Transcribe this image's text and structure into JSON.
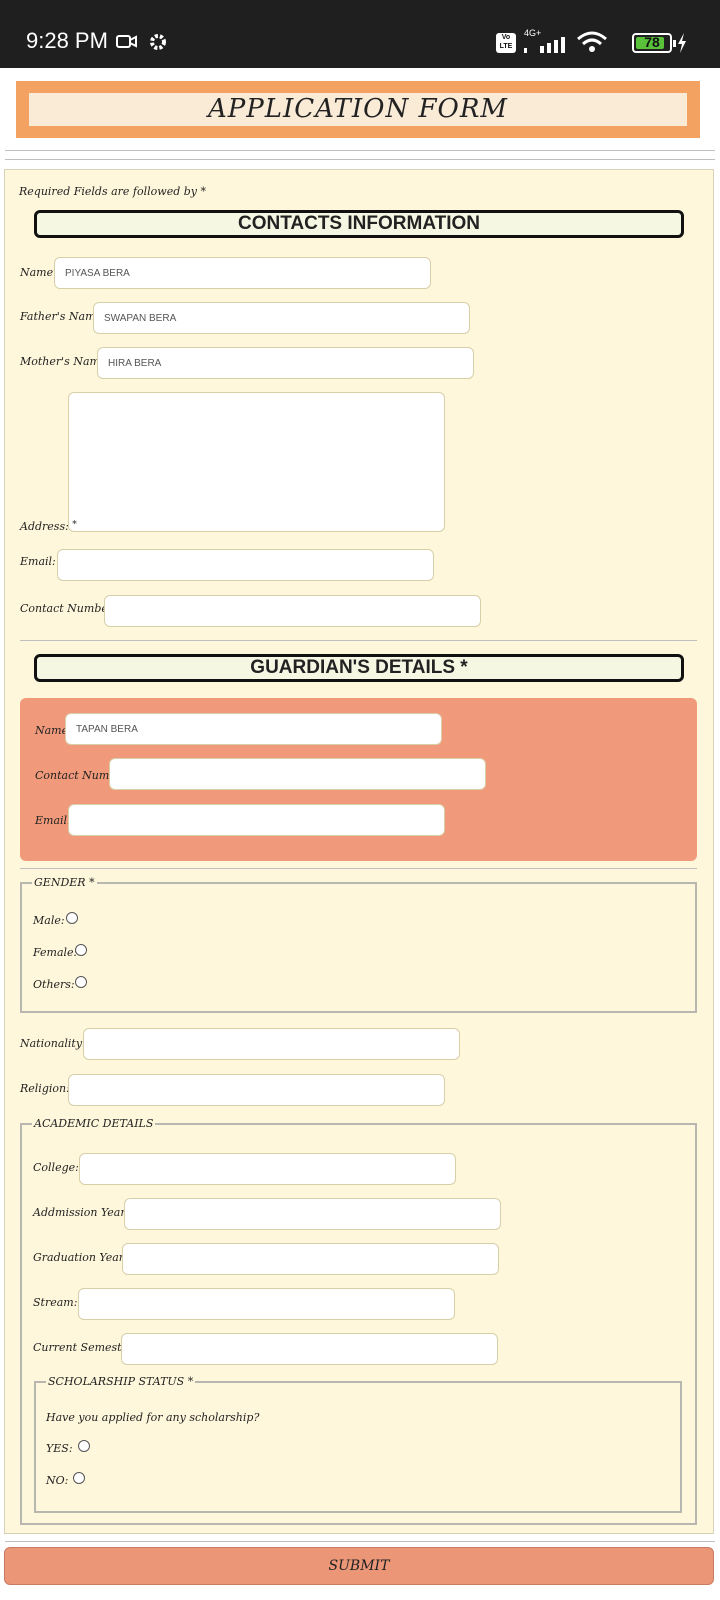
{
  "status_bar": {
    "time": "9:28 PM",
    "network": "4G+",
    "volte": "Vo LTE",
    "battery": "78",
    "icons": [
      "video-camera-icon",
      "gear-icon",
      "volte-icon",
      "signal-icon",
      "wifi-icon",
      "battery-icon",
      "charging-icon"
    ]
  },
  "form": {
    "title": "APPLICATION FORM",
    "required_note": "Required Fields are followed by *",
    "contacts": {
      "heading": "CONTACTS INFORMATION",
      "name_label": "Name",
      "name_value": "PIYASA BERA",
      "father_label": "Father's Name",
      "father_value": "SWAPAN BERA",
      "mother_label": "Mother's Name",
      "mother_value": "HIRA BERA",
      "address_label": "Address:",
      "address_value": "",
      "email_label": "Email:",
      "email_value": "",
      "contact_label": "Contact Number:",
      "contact_value": ""
    },
    "guardian": {
      "heading": "GUARDIAN'S DETAILS *",
      "name_label": "Name",
      "name_value": "TAPAN BERA",
      "contact_label": "Contact Number",
      "contact_value": "",
      "email_label": "Email:",
      "email_value": ""
    },
    "gender": {
      "legend": "GENDER *",
      "options": [
        "Male:",
        "Female:",
        "Others:"
      ]
    },
    "nationality_label": "Nationality:",
    "nationality_value": "",
    "religion_label": "Religion:",
    "religion_value": "",
    "academic": {
      "legend": "ACADEMIC DETAILS",
      "college_label": "College:",
      "college_value": "",
      "admission_label": "Addmission Year:",
      "admission_value": "",
      "graduation_label": "Graduation Year:",
      "graduation_value": "",
      "stream_label": "Stream:",
      "stream_value": "",
      "semester_label": "Current Semester",
      "semester_value": ""
    },
    "scholarship": {
      "legend": "SCHOLARSHIP STATUS *",
      "question": "Have you applied for any scholarship?",
      "options": [
        "YES:",
        "NO:"
      ]
    },
    "submit_label": "SUBMIT"
  },
  "colors": {
    "title_outer": "#f4a261",
    "title_inner": "#faebd7",
    "panel": "#fff7dc",
    "guardian_box": "#f09a7b",
    "submit": "#ea9677"
  }
}
